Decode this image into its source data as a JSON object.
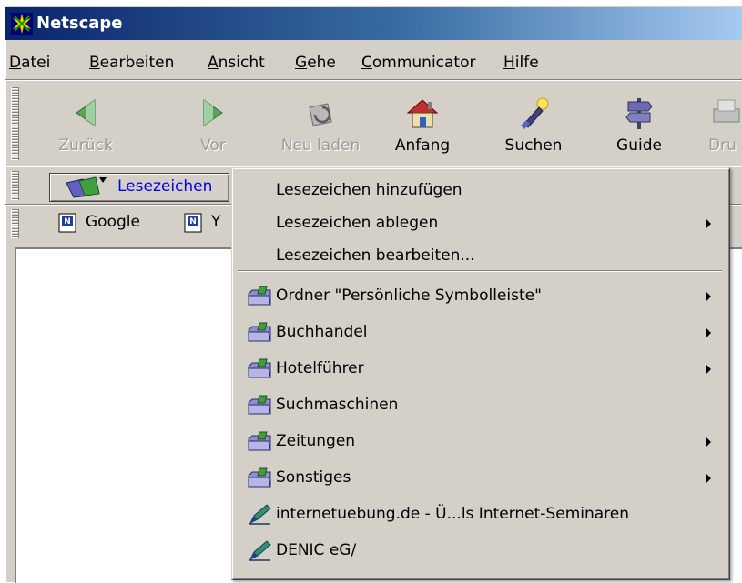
{
  "window": {
    "title": "Netscape",
    "titlebar_colors": [
      "#0a246a",
      "#a6caf0"
    ]
  },
  "menubar": {
    "items": [
      {
        "label": "Datei"
      },
      {
        "label": "Bearbeiten"
      },
      {
        "label": "Ansicht"
      },
      {
        "label": "Gehe"
      },
      {
        "label": "Communicator"
      },
      {
        "label": "Hilfe"
      }
    ]
  },
  "navigation": {
    "buttons": [
      {
        "label": "Zurück",
        "icon": "back-arrow-icon",
        "enabled": false
      },
      {
        "label": "Vor",
        "icon": "forward-arrow-icon",
        "enabled": false
      },
      {
        "label": "Neu laden",
        "icon": "reload-icon",
        "enabled": false
      },
      {
        "label": "Anfang",
        "icon": "home-icon",
        "enabled": true
      },
      {
        "label": "Suchen",
        "icon": "search-flashlight-icon",
        "enabled": true
      },
      {
        "label": "Guide",
        "icon": "guide-signpost-icon",
        "enabled": true
      },
      {
        "label": "Dru",
        "icon": "print-icon",
        "enabled": false
      }
    ]
  },
  "bookmarks_bar": {
    "button_label": "Lesezeichen"
  },
  "personal_toolbar": {
    "items": [
      {
        "label": "Google",
        "icon": "netscape-doc-icon"
      },
      {
        "label": "Y",
        "icon": "netscape-doc-icon"
      }
    ]
  },
  "bookmarks_menu": {
    "top_items": [
      {
        "label": "Lesezeichen hinzufügen",
        "submenu": false
      },
      {
        "label": "Lesezeichen ablegen",
        "submenu": true
      },
      {
        "label": "Lesezeichen bearbeiten...",
        "submenu": false
      }
    ],
    "folders": [
      {
        "label": "Ordner \"Persönliche Symbolleiste\"",
        "submenu": true,
        "icon": "folder-icon"
      },
      {
        "label": "Buchhandel",
        "submenu": true,
        "icon": "folder-icon"
      },
      {
        "label": "Hotelführer",
        "submenu": true,
        "icon": "folder-icon"
      },
      {
        "label": "Suchmaschinen",
        "submenu": false,
        "icon": "folder-icon"
      },
      {
        "label": "Zeitungen",
        "submenu": true,
        "icon": "folder-icon"
      },
      {
        "label": "Sonstiges",
        "submenu": true,
        "icon": "folder-icon"
      }
    ],
    "links": [
      {
        "label": "internetuebung.de - Ü...ls Internet-Seminaren",
        "icon": "bookmark-link-icon"
      },
      {
        "label": "DENIC eG/",
        "icon": "bookmark-link-icon"
      }
    ]
  }
}
